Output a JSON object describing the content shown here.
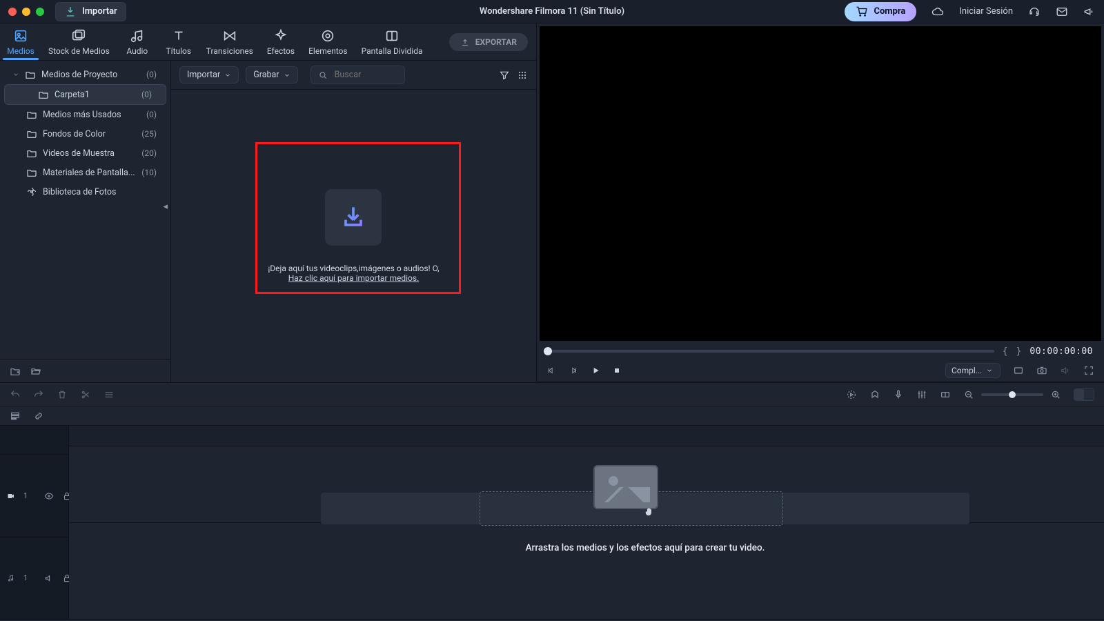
{
  "titlebar": {
    "import_label": "Importar",
    "window_title": "Wondershare Filmora 11 (Sin Título)",
    "buy_label": "Compra",
    "login_label": "Iniciar Sesión"
  },
  "tabs": {
    "media": "Medios",
    "stock": "Stock de Medios",
    "audio": "Audio",
    "titles": "Títulos",
    "transitions": "Transiciones",
    "effects": "Efectos",
    "elements": "Elementos",
    "split": "Pantalla Dividida",
    "export": "EXPORTAR"
  },
  "media_tree": {
    "project": {
      "label": "Medios de Proyecto",
      "count": "(0)"
    },
    "folder1": {
      "label": "Carpeta1",
      "count": "(0)"
    },
    "most_used": {
      "label": "Medios más Usados",
      "count": "(0)"
    },
    "color_bg": {
      "label": "Fondos de Color",
      "count": "(25)"
    },
    "sample_videos": {
      "label": "Videos de Muestra",
      "count": "(20)"
    },
    "green_screen": {
      "label": "Materiales de Pantalla...",
      "count": "(10)"
    },
    "photo_lib": {
      "label": "Biblioteca de Fotos"
    }
  },
  "media_toolbar": {
    "import_dd": "Importar",
    "record_dd": "Grabar",
    "search_placeholder": "Buscar"
  },
  "dropzone": {
    "line1": "¡Deja aquí tus videoclips,imágenes o audios! O,",
    "link": "Haz clic aquí para importar medios."
  },
  "preview": {
    "timecode": "00:00:00:00",
    "quality": "Compl..."
  },
  "timeline": {
    "video_track_label": "1",
    "audio_track_label": "1",
    "hint": "Arrastra los medios y los efectos aquí para crear tu video."
  }
}
